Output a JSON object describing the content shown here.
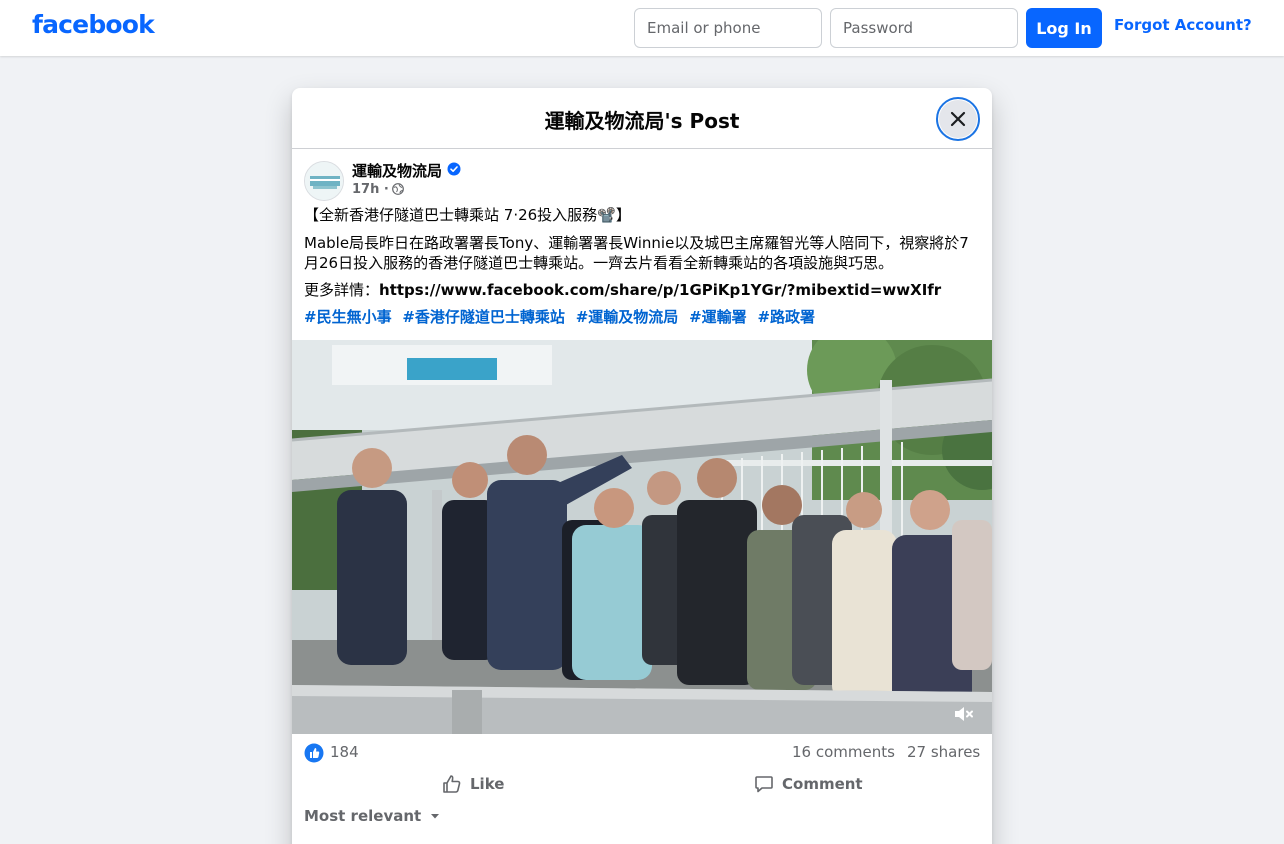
{
  "header": {
    "logo": "facebook",
    "email_placeholder": "Email or phone",
    "password_placeholder": "Password",
    "login_label": "Log In",
    "forgot_label": "Forgot Account?"
  },
  "modal": {
    "title": "運輸及物流局's Post"
  },
  "post": {
    "author": "運輸及物流局",
    "time": "17h ·",
    "line1": "【全新香港仔隧道巴士轉乘站 7·26投入服務📽️】",
    "line2": "Mable局長昨日在路政署署長Tony、運輸署署長Winnie以及城巴主席羅智光等人陪同下，視察將於7月26日投入服務的香港仔隧道巴士轉乘站。一齊去片看看全新轉乘站的各項設施與巧思。",
    "more_prefix": "更多詳情：",
    "more_link": "https://www.facebook.com/share/p/1GPiKp1YGr/?mibextid=wwXIfr",
    "hashtags": [
      "#民生無小事",
      "#香港仔隧道巴士轉乘站",
      "#運輸及物流局",
      "#運輸署",
      "#路政署"
    ]
  },
  "stats": {
    "likes": "184",
    "comments": "16 comments",
    "shares": "27 shares"
  },
  "actions": {
    "like": "Like",
    "comment": "Comment"
  },
  "comments_filter": "Most relevant",
  "colors": {
    "brand": "#0866ff",
    "hashtag": "#0064d1",
    "muted": "#65676b",
    "page_bg": "#f0f2f5"
  }
}
